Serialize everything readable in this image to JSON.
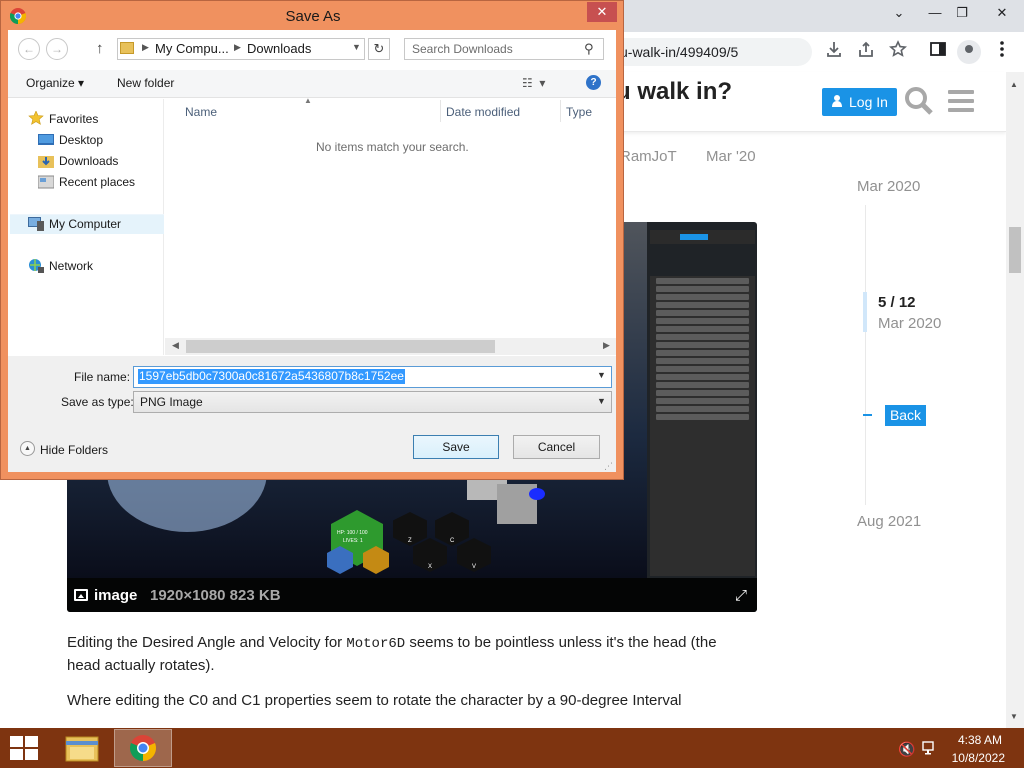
{
  "browser": {
    "url_fragment": "u-walk-in/499409/5",
    "window_controls": {
      "minimize": "—",
      "restore": "❐",
      "close": "✕",
      "tab_dropdown": "⌄"
    }
  },
  "page": {
    "topic_title": "u walk in?",
    "login_label": "Log In",
    "post_author": "RamJoT",
    "post_date": "Mar '20",
    "timeline": {
      "start": "Mar 2020",
      "position": "5 / 12",
      "position_date": "Mar 2020",
      "back_label": "Back",
      "end": "Aug 2021"
    },
    "embed": {
      "label": "image",
      "meta": "1920×1080 823 KB",
      "hud_text": "HP: 100 / 100",
      "hud_lives": "LIVES: 1",
      "keys": [
        "Z",
        "C",
        "X",
        "V"
      ]
    },
    "paragraph1_pre": "Editing the Desired Angle and Velocity for ",
    "paragraph1_code": "Motor6D",
    "paragraph1_post": " seems to be pointless unless it's the head (the head actually rotates).",
    "paragraph2": "Where editing the C0 and C1 properties seem to rotate the character by a 90-degree Interval"
  },
  "dialog": {
    "title": "Save As",
    "close_glyph": "✕",
    "address": {
      "segment1": "My Compu...",
      "segment2": "Downloads"
    },
    "search_placeholder": "Search Downloads",
    "organize_label": "Organize ▾",
    "new_folder_label": "New folder",
    "nav": {
      "favorites": "Favorites",
      "desktop": "Desktop",
      "downloads": "Downloads",
      "recent_places": "Recent places",
      "my_computer": "My Computer",
      "network": "Network"
    },
    "columns": {
      "name": "Name",
      "date_modified": "Date modified",
      "type": "Type"
    },
    "empty_message": "No items match your search.",
    "file_name_label": "File name:",
    "file_name_value": "1597eb5db0c7300a0c81672a5436807b8c1752ee",
    "save_as_type_label": "Save as type:",
    "save_as_type_value": "PNG Image",
    "hide_folders_label": "Hide Folders",
    "save_label": "Save",
    "cancel_label": "Cancel"
  },
  "taskbar": {
    "time": "4:38 AM",
    "date": "10/8/2022"
  },
  "colors": {
    "dialog_frame": "#f0915f",
    "taskbar": "#7e3410",
    "discourse_blue": "#1a93e6"
  }
}
